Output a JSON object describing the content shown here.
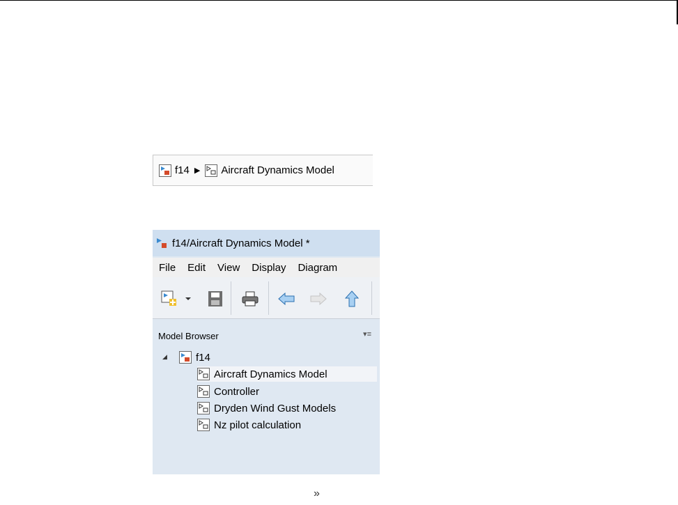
{
  "breadcrumb": {
    "root": "f14",
    "current": "Aircraft Dynamics Model"
  },
  "window": {
    "title": "f14/Aircraft Dynamics Model *",
    "menu": [
      "File",
      "Edit",
      "View",
      "Display",
      "Diagram"
    ],
    "model_browser_label": "Model Browser",
    "tree": {
      "root": "f14",
      "children": [
        "Aircraft Dynamics Model",
        "Controller",
        "Dryden Wind Gust Models",
        "Nz pilot calculation"
      ],
      "selected": "Aircraft Dynamics Model"
    }
  },
  "toolbar_icons": [
    "new-model-icon",
    "save-icon",
    "print-icon",
    "back-arrow-icon",
    "forward-arrow-icon",
    "up-arrow-icon"
  ],
  "overflow_glyph": "»"
}
